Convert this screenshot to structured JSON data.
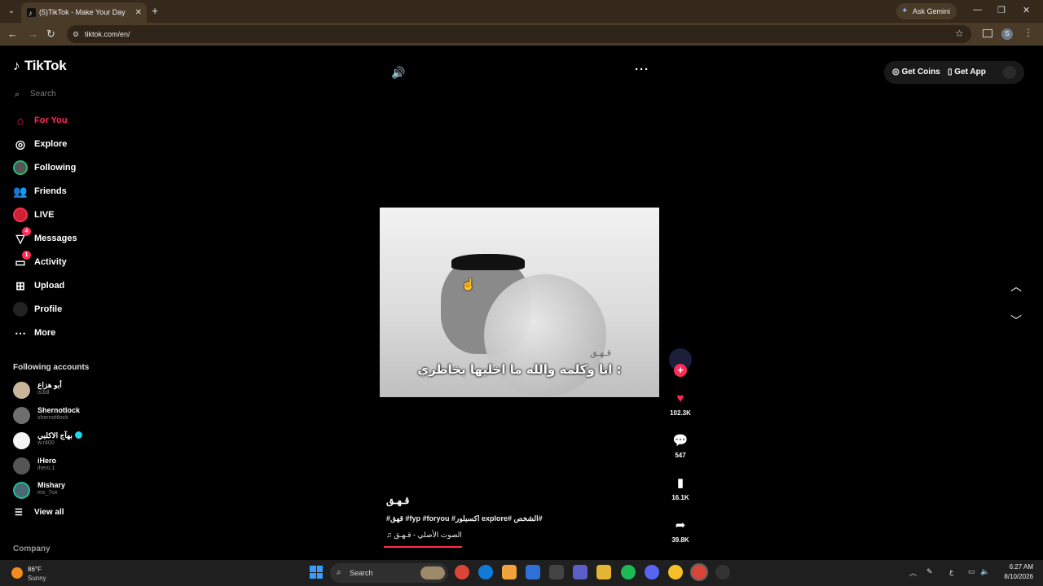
{
  "browser": {
    "tab_title": "(5)TikTok - Make Your Day",
    "tab_close": "✕",
    "new_tab": "+",
    "ask_gemini": "Ask Gemini",
    "url": "tiktok.com/en/",
    "profile_initial": "S"
  },
  "sidebar": {
    "logo_text": "TikTok",
    "search_placeholder": "Search",
    "nav": [
      {
        "label": "For You",
        "icon": "home-icon",
        "active": true
      },
      {
        "label": "Explore",
        "icon": "compass-icon"
      },
      {
        "label": "Following",
        "icon": "following-avatar-icon"
      },
      {
        "label": "Friends",
        "icon": "friends-icon"
      },
      {
        "label": "LIVE",
        "icon": "live-icon"
      },
      {
        "label": "Messages",
        "icon": "messages-icon",
        "badge": "4"
      },
      {
        "label": "Activity",
        "icon": "activity-icon",
        "badge": "1"
      },
      {
        "label": "Upload",
        "icon": "upload-icon"
      },
      {
        "label": "Profile",
        "icon": "profile-icon"
      },
      {
        "label": "More",
        "icon": "more-icon"
      }
    ],
    "following_title": "Following accounts",
    "accounts": [
      {
        "name": "أبو هزاع",
        "handle": "is3dl",
        "verified": false
      },
      {
        "name": "Shernotlock",
        "handle": "shernottlock",
        "verified": false
      },
      {
        "name": "بهآج الاكلبي",
        "handle": "w.r400",
        "verified": true
      },
      {
        "name": "iHero",
        "handle": "ihero.1",
        "verified": false
      },
      {
        "name": "Mishary",
        "handle": "mx_7ox",
        "verified": false
      }
    ],
    "view_all": "View all",
    "company": "Company"
  },
  "header": {
    "get_coins": "Get Coins",
    "get_app": "Get App"
  },
  "video": {
    "watermark": "قـهـق",
    "subtitle": "انا وكلمه والله ما اخليها بخاطري :",
    "likes": "102.3K",
    "comments": "547",
    "saves": "16.1K",
    "shares": "39.8K",
    "username": "قـهـق",
    "tags": "#قهق #fyp #foryou #اكسبلور explore# الشخص#",
    "music": "الصوت الأصلي - قـهـق",
    "progress": 0.28
  },
  "taskbar": {
    "temp": "86°F",
    "condition": "Sunny",
    "search": "Search",
    "time": "6:27 AM",
    "date": "8/10/2026",
    "lang": "ع"
  }
}
